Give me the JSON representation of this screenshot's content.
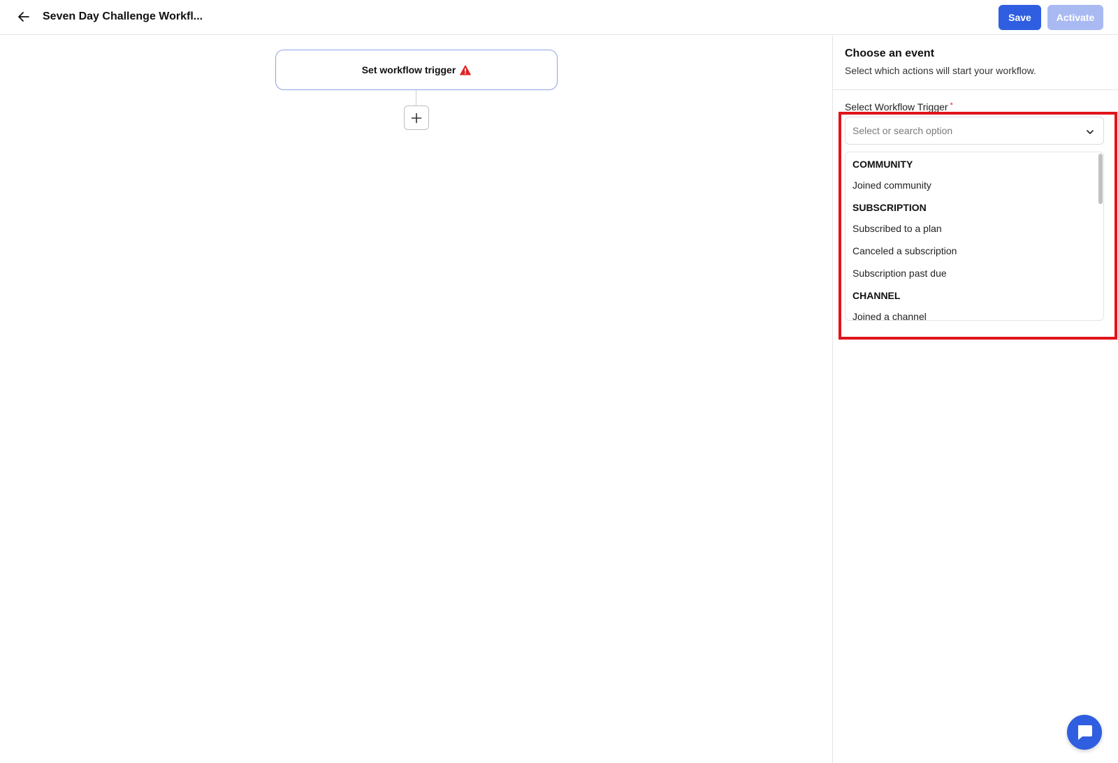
{
  "header": {
    "title": "Seven Day Challenge Workfl...",
    "save_label": "Save",
    "activate_label": "Activate"
  },
  "canvas": {
    "trigger_node_label": "Set workflow trigger",
    "trigger_warning_icon": "warning-triangle-icon",
    "add_step_icon": "plus-icon"
  },
  "panel": {
    "title": "Choose an event",
    "subtitle": "Select which actions will start your workflow.",
    "field_label": "Select Workflow Trigger",
    "required_mark": "*",
    "select_placeholder": "Select or search option",
    "groups": [
      {
        "header": "COMMUNITY",
        "options": [
          "Joined community"
        ]
      },
      {
        "header": "SUBSCRIPTION",
        "options": [
          "Subscribed to a plan",
          "Canceled a subscription",
          "Subscription past due"
        ]
      },
      {
        "header": "CHANNEL",
        "options": [
          "Joined a channel"
        ]
      }
    ]
  },
  "colors": {
    "primary": "#2f5fe0",
    "primary_disabled": "#a9baf3",
    "highlight": "#e0141b",
    "warning": "#e02424"
  }
}
